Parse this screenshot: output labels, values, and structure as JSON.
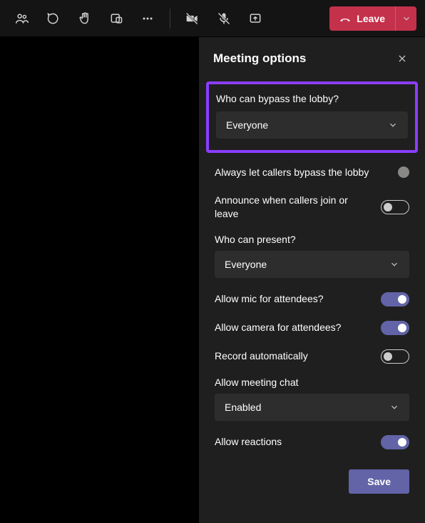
{
  "toolbar": {
    "leave_label": "Leave"
  },
  "panel": {
    "title": "Meeting options",
    "bypass": {
      "label": "Who can bypass the lobby?",
      "value": "Everyone"
    },
    "callers_bypass": {
      "label": "Always let callers bypass the lobby",
      "on": false
    },
    "announce": {
      "label": "Announce when callers join or leave",
      "on": false
    },
    "present": {
      "label": "Who can present?",
      "value": "Everyone"
    },
    "allow_mic": {
      "label": "Allow mic for attendees?",
      "on": true
    },
    "allow_camera": {
      "label": "Allow camera for attendees?",
      "on": true
    },
    "record_auto": {
      "label": "Record automatically",
      "on": false
    },
    "meeting_chat": {
      "label": "Allow meeting chat",
      "value": "Enabled"
    },
    "allow_reactions": {
      "label": "Allow reactions",
      "on": true
    },
    "save_label": "Save"
  }
}
